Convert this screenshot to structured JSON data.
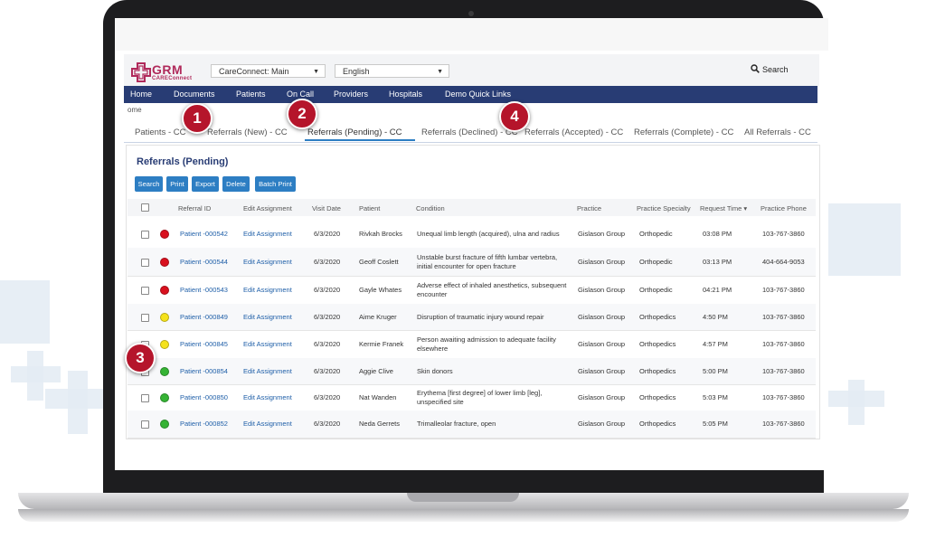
{
  "colors": {
    "nav": "#283c74",
    "button": "#2d7ec3",
    "badge": "#b5152b",
    "red": "#d9101e",
    "yellow": "#f5e21b",
    "green": "#35b334",
    "brand": "#b02a5b"
  },
  "app": {
    "logo_text": "GRM",
    "logo_sub": "CAREConnect"
  },
  "selects": {
    "site": "CareConnect: Main",
    "language": "English"
  },
  "search": {
    "label": "Search",
    "icon": "search-icon"
  },
  "nav": [
    "Home",
    "Documents",
    "Patients",
    "On Call",
    "Providers",
    "Hospitals",
    "Demo Quick Links"
  ],
  "breadcrumb": "ome",
  "tabs": [
    "Patients - CC",
    "Referrals (New) - CC",
    "Referrals (Pending) - CC",
    "Referrals (Declined) - CC",
    "Referrals (Accepted) - CC",
    "Referrals (Complete) - CC",
    "All Referrals - CC"
  ],
  "section_title": "Referrals (Pending)",
  "toolbar": [
    "Search",
    "Print",
    "Export",
    "Delete",
    "Batch Print"
  ],
  "table": {
    "headers": [
      "Referral ID",
      "Edit Assignment",
      "Visit Date",
      "Patient",
      "Condition",
      "Practice",
      "Practice Specialty",
      "Request Time",
      "Practice Phone"
    ],
    "sort_indicator": "▾",
    "rows": [
      {
        "status": "red",
        "id": "Patient -000542",
        "edit": "Edit Assignment",
        "date": "6/3/2020",
        "patient": "Rivkah Brocks",
        "condition": "Unequal limb length (acquired), ulna and radius",
        "practice": "Gislason Group",
        "specialty": "Orthopedic",
        "time": "03:08 PM",
        "phone": "103-767-3860"
      },
      {
        "status": "red",
        "id": "Patient -000544",
        "edit": "Edit Assignment",
        "date": "6/3/2020",
        "patient": "Geoff Coslett",
        "condition": "Unstable burst fracture of fifth lumbar vertebra, initial encounter for open fracture",
        "practice": "Gislason Group",
        "specialty": "Orthopedic",
        "time": "03:13 PM",
        "phone": "404-664-9053"
      },
      {
        "status": "red",
        "id": "Patient -000543",
        "edit": "Edit Assignment",
        "date": "6/3/2020",
        "patient": "Gayle Whates",
        "condition": "Adverse effect of inhaled anesthetics, subsequent encounter",
        "practice": "Gislason Group",
        "specialty": "Orthopedic",
        "time": "04:21 PM",
        "phone": "103-767-3860"
      },
      {
        "status": "yellow",
        "id": "Patient -000849",
        "edit": "Edit Assignment",
        "date": "6/3/2020",
        "patient": "Aime Kruger",
        "condition": "Disruption of traumatic injury wound repair",
        "practice": "Gislason Group",
        "specialty": "Orthopedics",
        "time": "4:50 PM",
        "phone": "103-767-3860"
      },
      {
        "status": "yellow",
        "id": "Patient -000845",
        "edit": "Edit Assignment",
        "date": "6/3/2020",
        "patient": "Kermie Franek",
        "condition": "Person awaiting admission to adequate facility elsewhere",
        "practice": "Gislason Group",
        "specialty": "Orthopedics",
        "time": "4:57 PM",
        "phone": "103-767-3860"
      },
      {
        "status": "green",
        "id": "Patient -000854",
        "edit": "Edit Assignment",
        "date": "6/3/2020",
        "patient": "Aggie Clive",
        "condition": "Skin donors",
        "practice": "Gislason Group",
        "specialty": "Orthopedics",
        "time": "5:00 PM",
        "phone": "103-767-3860"
      },
      {
        "status": "green",
        "id": "Patient -000850",
        "edit": "Edit Assignment",
        "date": "6/3/2020",
        "patient": "Nat Wanden",
        "condition": "Erythema [first degree] of lower limb [leg], unspecified site",
        "practice": "Gislason Group",
        "specialty": "Orthopedics",
        "time": "5:03 PM",
        "phone": "103-767-3860"
      },
      {
        "status": "green",
        "id": "Patient -000852",
        "edit": "Edit Assignment",
        "date": "6/3/2020",
        "patient": "Neda Gerrets",
        "condition": "Trimalleolar fracture, open",
        "practice": "Gislason Group",
        "specialty": "Orthopedics",
        "time": "5:05 PM",
        "phone": "103-767-3860"
      }
    ]
  },
  "callouts": [
    "1",
    "2",
    "3",
    "4"
  ]
}
